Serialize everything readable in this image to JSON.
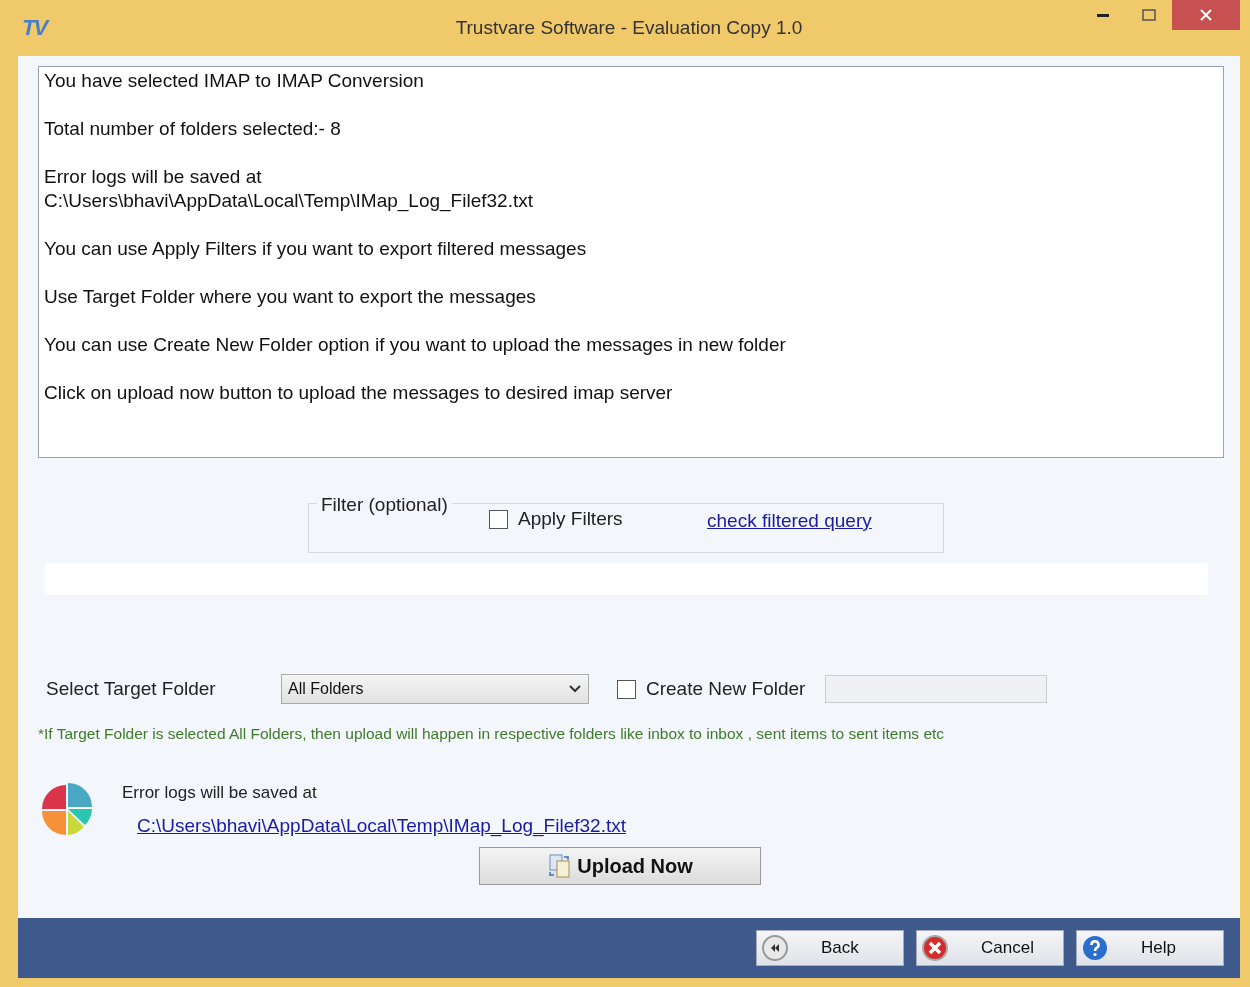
{
  "window": {
    "logo": "TV",
    "title": "Trustvare Software - Evaluation Copy 1.0"
  },
  "info_lines": [
    "You have selected IMAP to IMAP Conversion",
    "Total number of folders selected:- 8",
    "Error logs will be saved at\nC:\\Users\\bhavi\\AppData\\Local\\Temp\\IMap_Log_Filef32.txt",
    "You can use Apply Filters if you want to export filtered messages",
    "Use Target Folder where you want to export the messages",
    "You can use Create New Folder option if you want to upload the messages in new folder",
    "Click on upload now button to upload the messages to desired imap server"
  ],
  "filter": {
    "legend": "Filter (optional)",
    "apply_filters": {
      "label": "Apply Filters",
      "checked": false
    },
    "link": "check filtered query"
  },
  "target": {
    "label": "Select Target Folder",
    "value": "All Folders",
    "create_new_folder": {
      "label": "Create New Folder",
      "checked": false
    },
    "note": "*If Target Folder is selected All Folders, then upload will happen in respective folders like inbox to inbox , sent items to sent items etc"
  },
  "log": {
    "label": "Error logs will be saved at",
    "path": "C:\\Users\\bhavi\\AppData\\Local\\Temp\\IMap_Log_Filef32.txt"
  },
  "upload_button": "Upload Now",
  "footer_buttons": [
    {
      "kind": "back",
      "label": "Back"
    },
    {
      "kind": "cancel",
      "label": "Cancel"
    },
    {
      "kind": "help",
      "label": "Help"
    }
  ]
}
